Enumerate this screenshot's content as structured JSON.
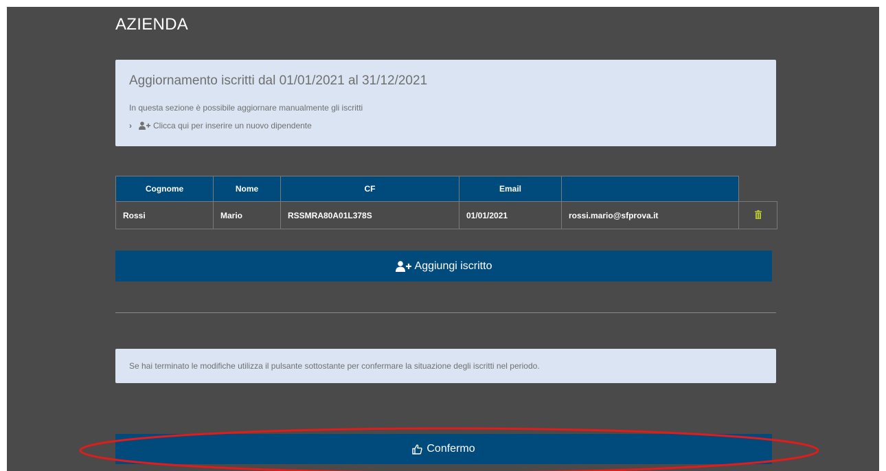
{
  "page": {
    "title": "AZIENDA"
  },
  "info": {
    "heading": "Aggiornamento iscritti dal 01/01/2021 al 31/12/2021",
    "description": "In questa sezione è possibile aggiornare manualmente gli iscritti",
    "add_link": "Clicca qui per inserire un nuovo dipendente"
  },
  "table": {
    "headers": [
      "Cognome",
      "Nome",
      "CF",
      "Email",
      ""
    ],
    "rows": [
      {
        "cognome": "Rossi",
        "nome": "Mario",
        "cf": "RSSMRA80A01L378S",
        "date": "01/01/2021",
        "email": "rossi.mario@sfprova.it"
      }
    ]
  },
  "actions": {
    "add_label": "Aggiungi iscritto",
    "confirm_label": "Confermo"
  },
  "note": {
    "text": "Se hai terminato le modifiche utilizza il pulsante sottostante per confermare la situazione degli iscritti nel periodo."
  },
  "icons": {
    "add_user": "user-plus-icon",
    "delete": "trash-icon",
    "confirm": "thumbs-up-icon",
    "expand": "chevron-right-icon"
  },
  "colors": {
    "panel_bg": "#4a4a4a",
    "primary": "#004a7c",
    "info_bg": "#dae4f2",
    "trash": "#b5c531",
    "highlight": "#e21b1b"
  }
}
